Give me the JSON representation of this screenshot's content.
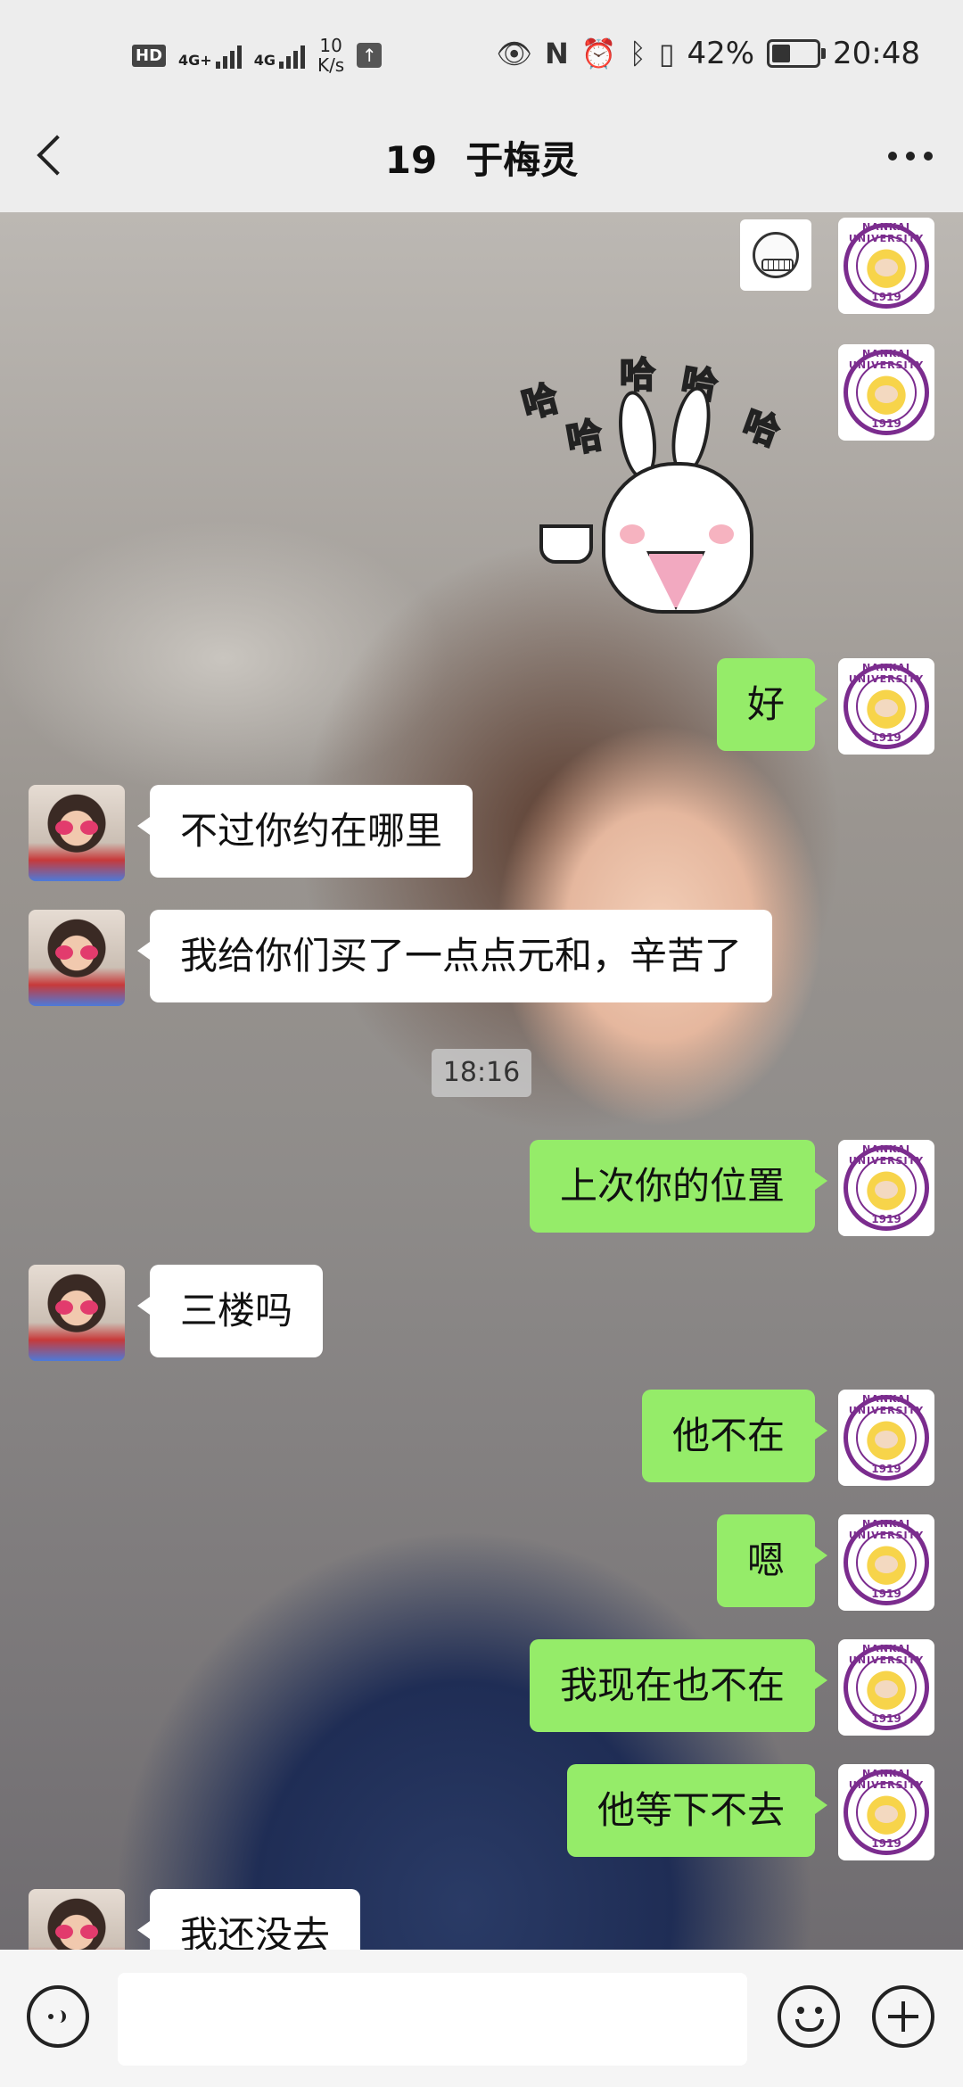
{
  "status_bar": {
    "hd": "HD",
    "signal1": "4G+",
    "signal2": "4G",
    "net_speed_value": "10",
    "net_speed_unit": "K/s",
    "battery": "42%",
    "battery_level": 0.42,
    "time": "20:48"
  },
  "header": {
    "group_number": "19",
    "contact_name": "于梅灵"
  },
  "avatars": {
    "me_seal_text": "NANKAI UNIVERSITY",
    "me_seal_year": "1919"
  },
  "messages": [
    {
      "side": "out",
      "type": "sticker",
      "sticker": "grin-face-sticker"
    },
    {
      "side": "out",
      "type": "sticker",
      "sticker": "rabbit-haha-sticker",
      "text": [
        "哈",
        "哈",
        "哈",
        "哈",
        "哈"
      ]
    },
    {
      "side": "out",
      "type": "text",
      "text": "好"
    },
    {
      "side": "in",
      "type": "text",
      "text": "不过你约在哪里"
    },
    {
      "side": "in",
      "type": "text",
      "text": "我给你们买了一点点元和，辛苦了"
    },
    {
      "side": "out",
      "type": "text",
      "text": "上次你的位置"
    },
    {
      "side": "in",
      "type": "text",
      "text": "三楼吗"
    },
    {
      "side": "out",
      "type": "text",
      "text": "他不在"
    },
    {
      "side": "out",
      "type": "text",
      "text": "嗯"
    },
    {
      "side": "out",
      "type": "text",
      "text": "我现在也不在"
    },
    {
      "side": "out",
      "type": "text",
      "text": "他等下不去"
    },
    {
      "side": "in",
      "type": "text",
      "text": "我还没去"
    }
  ],
  "timestamp": "18:16",
  "input_bar": {
    "voice_icon": "voice-icon",
    "emoji_icon": "emoji-icon",
    "plus_icon": "plus-icon",
    "text_value": ""
  }
}
